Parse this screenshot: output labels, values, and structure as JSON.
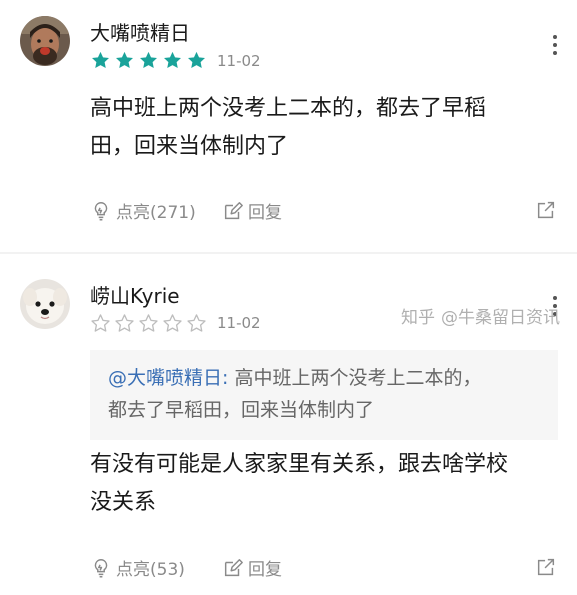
{
  "comments": [
    {
      "username": "大嘴喷精日",
      "rating": 5,
      "date": "11-02",
      "content_line1": "高中班上两个没考上二本的，都去了早稻",
      "content_line2": "田，回来当体制内了",
      "like_label": "点亮(271)",
      "reply_label": "回复",
      "avatar": "avatar-photo-man"
    },
    {
      "username": "崂山Kyrie",
      "rating": 0,
      "date": "11-02",
      "quote_mention": "@大嘴喷精日:",
      "quote_text_line1": "高中班上两个没考上二本的，",
      "quote_text_line2": "都去了早稻田，回来当体制内了",
      "content_line1": "有没有可能是人家家里有关系，跟去啥学校",
      "content_line2": "没关系",
      "like_label": "点亮(53)",
      "reply_label": "回复",
      "avatar": "avatar-photo-dog"
    }
  ],
  "watermark": {
    "site": "知乎",
    "author": "@牛桑留日资讯"
  },
  "colors": {
    "star_filled": "#1aa39a",
    "star_empty": "#bdbdbd",
    "mention": "#3a6fb5",
    "meta_text": "#8a8a8a"
  }
}
